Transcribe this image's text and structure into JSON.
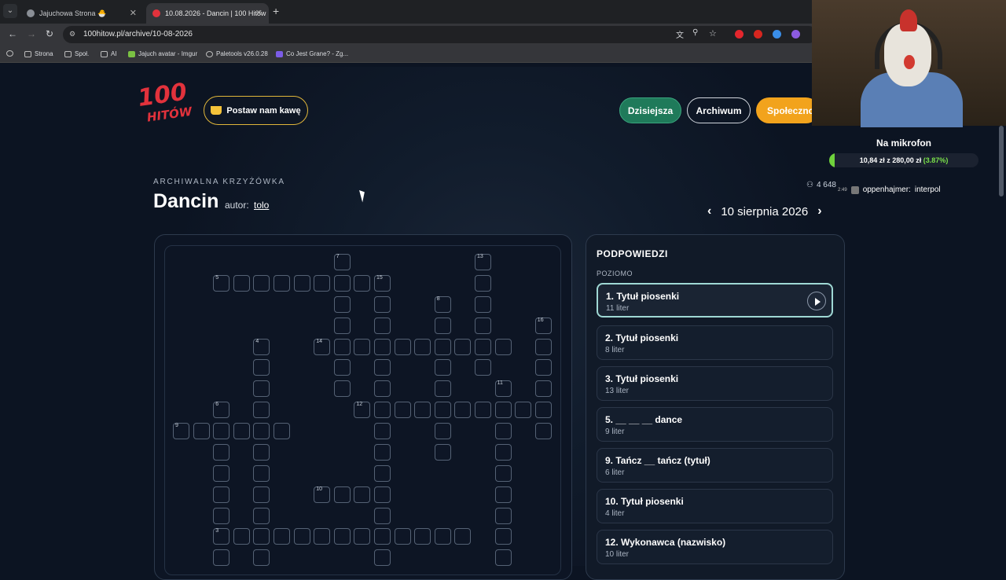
{
  "browser": {
    "tabs": [
      {
        "title": "Jajuchowa Strona 🐣",
        "active": false
      },
      {
        "title": "10.08.2026 - Dancin | 100 Hitów",
        "active": true
      }
    ],
    "url": "100hitow.pl/archive/10-08-2026",
    "bookmarks": [
      "Strona",
      "Społ.",
      "AI",
      "Jajuch avatar - Imgur",
      "Paletools v26.0.28",
      "Co Jest Grane? - Zg..."
    ]
  },
  "header": {
    "logo_number": "100",
    "logo_word": "HITÓW",
    "coffee_label": "Postaw nam kawę",
    "nav": [
      "Dzisiejsza",
      "Archiwum",
      "Społeczność"
    ]
  },
  "puzzle": {
    "subtitle": "ARCHIWALNA KRZYŻÓWKA",
    "title": "Dancin",
    "author_label": "autor:",
    "author": "tolo",
    "date": "10 sierpnia 2026",
    "prev_icon": "chevron-left-icon",
    "next_icon": "chevron-right-icon"
  },
  "clues": {
    "heading": "PODPOWIEDZI",
    "section": "POZIOMO",
    "items": [
      {
        "title": "1. Tytuł piosenki",
        "sub": "11 liter"
      },
      {
        "title": "2. Tytuł piosenki",
        "sub": "8 liter"
      },
      {
        "title": "3. Tytuł piosenki",
        "sub": "13 liter"
      },
      {
        "title": "5. __ __ __ dance",
        "sub": "9 liter"
      },
      {
        "title": "9. Tańcz __ tańcz (tytuł)",
        "sub": "6 liter"
      },
      {
        "title": "10. Tytuł piosenki",
        "sub": "4 liter"
      },
      {
        "title": "12. Wykonawca (nazwisko)",
        "sub": "10 liter"
      }
    ]
  },
  "overlay": {
    "mic_title": "Na mikrofon",
    "mic_amount": "10,84 zł",
    "mic_of": "z",
    "mic_goal": "280,00 zł",
    "mic_pct": "(3.87%)",
    "mic_fraction": 0.0387,
    "viewers": "4 648",
    "chat_time": "2:49",
    "chat_user": "oppenhajmer:",
    "chat_msg": "interpol"
  },
  "colors": {
    "accent_green": "#1f7a5a",
    "accent_orange": "#f2a31c",
    "brand_red": "#e2323c"
  }
}
